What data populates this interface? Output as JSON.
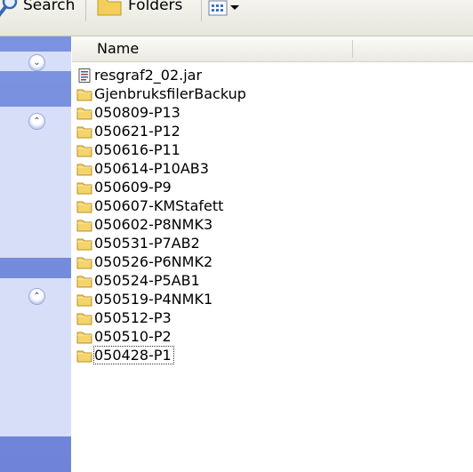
{
  "toolbar": {
    "search_label": "Search",
    "folders_label": "Folders"
  },
  "taskpane": {
    "colors": {
      "background": "#7088db",
      "box": "#d7def8"
    }
  },
  "list": {
    "column_name": "Name",
    "items": [
      {
        "name": "resgraf2_02.jar",
        "icon": "jar-file-icon"
      },
      {
        "name": "GjenbruksfilerBackup",
        "icon": "folder-icon"
      },
      {
        "name": "050809-P13",
        "icon": "folder-icon"
      },
      {
        "name": "050621-P12",
        "icon": "folder-icon"
      },
      {
        "name": "050616-P11",
        "icon": "folder-icon"
      },
      {
        "name": "050614-P10AB3",
        "icon": "folder-icon"
      },
      {
        "name": "050609-P9",
        "icon": "folder-icon"
      },
      {
        "name": "050607-KMStafett",
        "icon": "folder-icon"
      },
      {
        "name": "050602-P8NMK3",
        "icon": "folder-icon"
      },
      {
        "name": "050531-P7AB2",
        "icon": "folder-icon"
      },
      {
        "name": "050526-P6NMK2",
        "icon": "folder-icon"
      },
      {
        "name": "050524-P5AB1",
        "icon": "folder-icon"
      },
      {
        "name": "050519-P4NMK1",
        "icon": "folder-icon"
      },
      {
        "name": "050512-P3",
        "icon": "folder-icon"
      },
      {
        "name": "050510-P2",
        "icon": "folder-icon"
      },
      {
        "name": "050428-P1",
        "icon": "folder-icon",
        "selected": true
      }
    ]
  }
}
